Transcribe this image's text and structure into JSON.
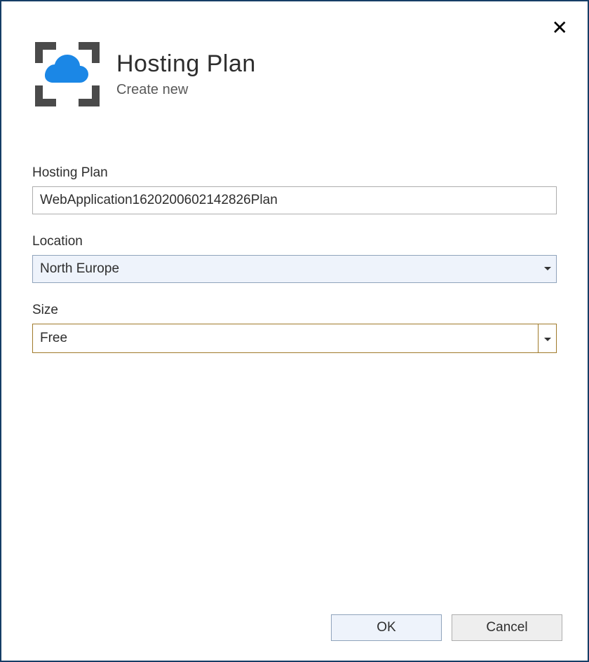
{
  "header": {
    "title": "Hosting Plan",
    "subtitle": "Create new"
  },
  "fields": {
    "hostingPlan": {
      "label": "Hosting Plan",
      "value": "WebApplication1620200602142826Plan"
    },
    "location": {
      "label": "Location",
      "value": "North Europe"
    },
    "size": {
      "label": "Size",
      "value": "Free"
    }
  },
  "footer": {
    "ok": "OK",
    "cancel": "Cancel"
  }
}
